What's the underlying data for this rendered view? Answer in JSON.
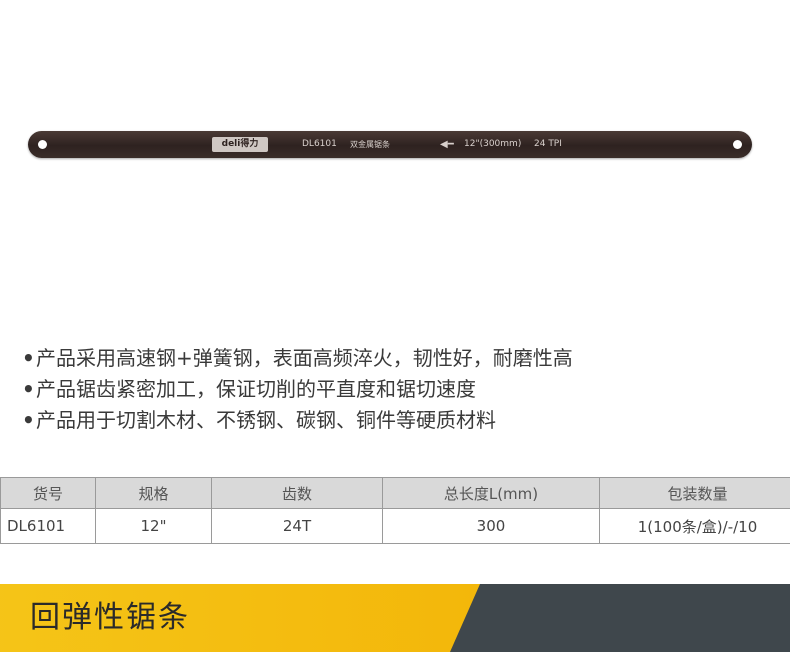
{
  "blade": {
    "brand": "deli得力",
    "model": "DL6101",
    "name": "双金属锯条",
    "arrow": "◀━",
    "length": "12\"(300mm)",
    "tpi": "24 TPI"
  },
  "features": [
    "产品采用高速钢+弹簧钢，表面高频淬火，韧性好，耐磨性高",
    "产品锯齿紧密加工，保证切削的平直度和锯切速度",
    "产品用于切割木材、不锈钢、碳钢、铜件等硬质材料"
  ],
  "bullet": "•",
  "table": {
    "headers": [
      "货号",
      "规格",
      "齿数",
      "总长度L(mm)",
      "包装数量"
    ],
    "row": [
      "DL6101",
      "12\"",
      "24T",
      "300",
      "1(100条/盒)/-/10"
    ]
  },
  "banner": {
    "title": "回弹性锯条",
    "colors": {
      "accent": "#f5c518",
      "dark": "#3f474c"
    }
  }
}
